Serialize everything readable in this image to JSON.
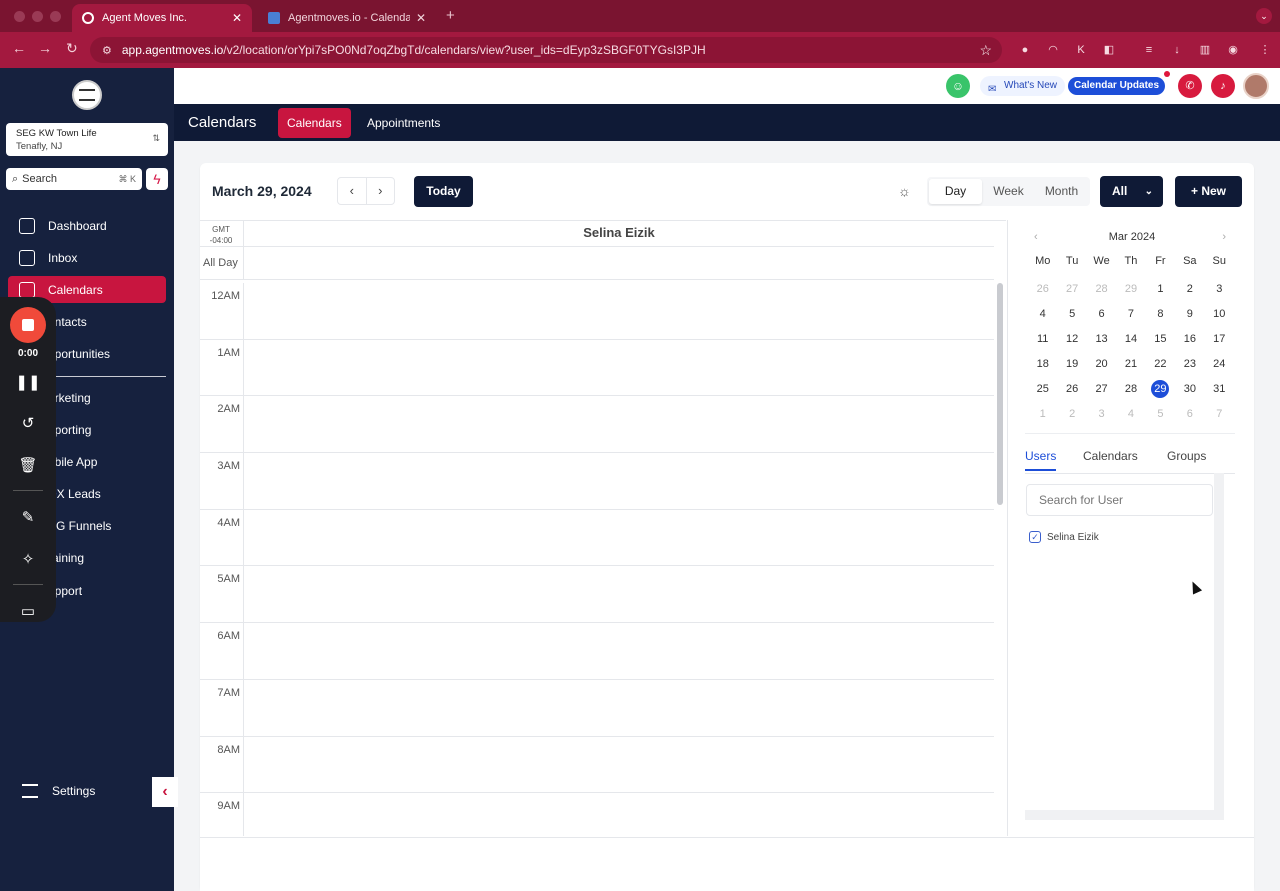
{
  "browser": {
    "tabs": [
      {
        "label": "Agent Moves Inc.",
        "active": true
      },
      {
        "label": "Agentmoves.io - Calendar - F",
        "active": false
      }
    ],
    "url_host": "app.agentmoves.io",
    "url_path": "/v2/location/orYpi7sPO0Nd7oqZbgTd/calendars/view?user_ids=dEyp3zSBGF0TYGsI3PJH"
  },
  "sidebar": {
    "location_name": "SEG KW Town Life",
    "location_sub": "Tenafly, NJ",
    "search_placeholder": "Search",
    "search_shortcut": "⌘ K",
    "items": [
      {
        "label": "Dashboard",
        "active": false
      },
      {
        "label": "Inbox",
        "active": false
      },
      {
        "label": "Calendars",
        "active": true
      },
      {
        "label": "ontacts",
        "active": false
      },
      {
        "label": "pportunities",
        "active": false
      },
      {
        "label": "arketing",
        "active": false
      },
      {
        "label": "eporting",
        "active": false
      },
      {
        "label": "obile App",
        "active": false
      },
      {
        "label": "DX Leads",
        "active": false
      },
      {
        "label": "EG Funnels",
        "active": false
      },
      {
        "label": "raining",
        "active": false
      },
      {
        "label": "upport",
        "active": false
      }
    ],
    "settings_label": "Settings"
  },
  "recorder": {
    "time": "0:00"
  },
  "topbar": {
    "whats_new": "What's New",
    "calendar_updates": "Calendar Updates"
  },
  "subnav": {
    "title": "Calendars",
    "tabs": [
      "Calendars",
      "Appointments"
    ]
  },
  "toolbar": {
    "date": "March 29, 2024",
    "today": "Today",
    "views": [
      "Day",
      "Week",
      "Month"
    ],
    "active_view": "Day",
    "filter": "All",
    "new": "New"
  },
  "day_view": {
    "timezone_line1": "GMT",
    "timezone_line2": "-04:00",
    "user": "Selina Eizik",
    "all_day": "All Day",
    "hours": [
      "12AM",
      "1AM",
      "2AM",
      "3AM",
      "4AM",
      "5AM",
      "6AM",
      "7AM",
      "8AM",
      "9AM"
    ]
  },
  "mini_calendar": {
    "month": "Mar 2024",
    "weekdays": [
      "Mo",
      "Tu",
      "We",
      "Th",
      "Fr",
      "Sa",
      "Su"
    ],
    "days": [
      [
        "26",
        "27",
        "28",
        "29",
        "1",
        "2",
        "3"
      ],
      [
        "4",
        "5",
        "6",
        "7",
        "8",
        "9",
        "10"
      ],
      [
        "11",
        "12",
        "13",
        "14",
        "15",
        "16",
        "17"
      ],
      [
        "18",
        "19",
        "20",
        "21",
        "22",
        "23",
        "24"
      ],
      [
        "25",
        "26",
        "27",
        "28",
        "29",
        "30",
        "31"
      ],
      [
        "1",
        "2",
        "3",
        "4",
        "5",
        "6",
        "7"
      ]
    ],
    "selected": "29"
  },
  "panel": {
    "tabs": [
      "Users",
      "Calendars",
      "Groups"
    ],
    "search_placeholder": "Search for User",
    "users": [
      {
        "name": "Selina Eizik",
        "checked": true
      }
    ]
  },
  "colors": {
    "brand_red": "#c8153f",
    "navy": "#0f1a36",
    "selected_blue": "#1d4ed8"
  }
}
